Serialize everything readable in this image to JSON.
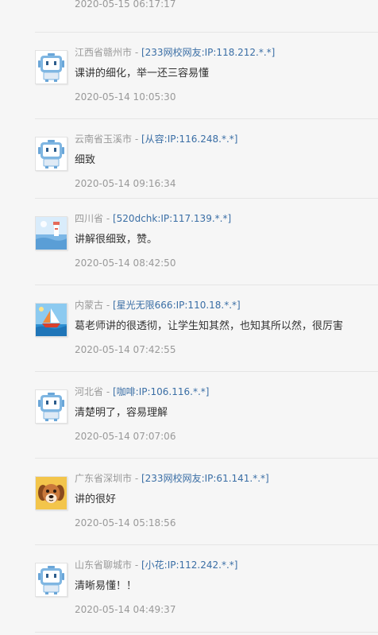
{
  "top_item": {
    "time": "2020-05-15 06:17:17"
  },
  "comments": [
    {
      "location": "江西省赣州市",
      "separator": " - ",
      "user": "[233网校网友:IP:118.212.*.*]",
      "text": "课讲的细化，举一还三容易懂",
      "time": "2020-05-14 10:05:30",
      "avatar": "robot"
    },
    {
      "location": "云南省玉溪市",
      "separator": " - ",
      "user": "[从容:IP:116.248.*.*]",
      "text": "细致",
      "time": "2020-05-14 09:16:34",
      "avatar": "robot"
    },
    {
      "location": "四川省",
      "separator": " - ",
      "user": "[520dchk:IP:117.139.*.*]",
      "text": "讲解很细致，赞。",
      "time": "2020-05-14 08:42:50",
      "avatar": "lighthouse"
    },
    {
      "location": "内蒙古",
      "separator": " - ",
      "user": "[星光无限666:IP:110.18.*.*]",
      "text": "葛老师讲的很透彻，让学生知其然，也知其所以然，很厉害",
      "time": "2020-05-14 07:42:55",
      "avatar": "sailboat"
    },
    {
      "location": "河北省",
      "separator": " - ",
      "user": "[咖啡:IP:106.116.*.*]",
      "text": "清楚明了，容易理解",
      "time": "2020-05-14 07:07:06",
      "avatar": "robot"
    },
    {
      "location": "广东省深圳市",
      "separator": " - ",
      "user": "[233网校网友:IP:61.141.*.*]",
      "text": "讲的很好",
      "time": "2020-05-14 05:18:56",
      "avatar": "dog"
    },
    {
      "location": "山东省聊城市",
      "separator": " - ",
      "user": "[小花:IP:112.242.*.*]",
      "text": "清晰易懂！！",
      "time": "2020-05-14 04:49:37",
      "avatar": "robot"
    }
  ],
  "colors": {
    "link": "#3a6ea5",
    "muted": "#999999",
    "text": "#333333",
    "background": "#f6f6f6"
  }
}
